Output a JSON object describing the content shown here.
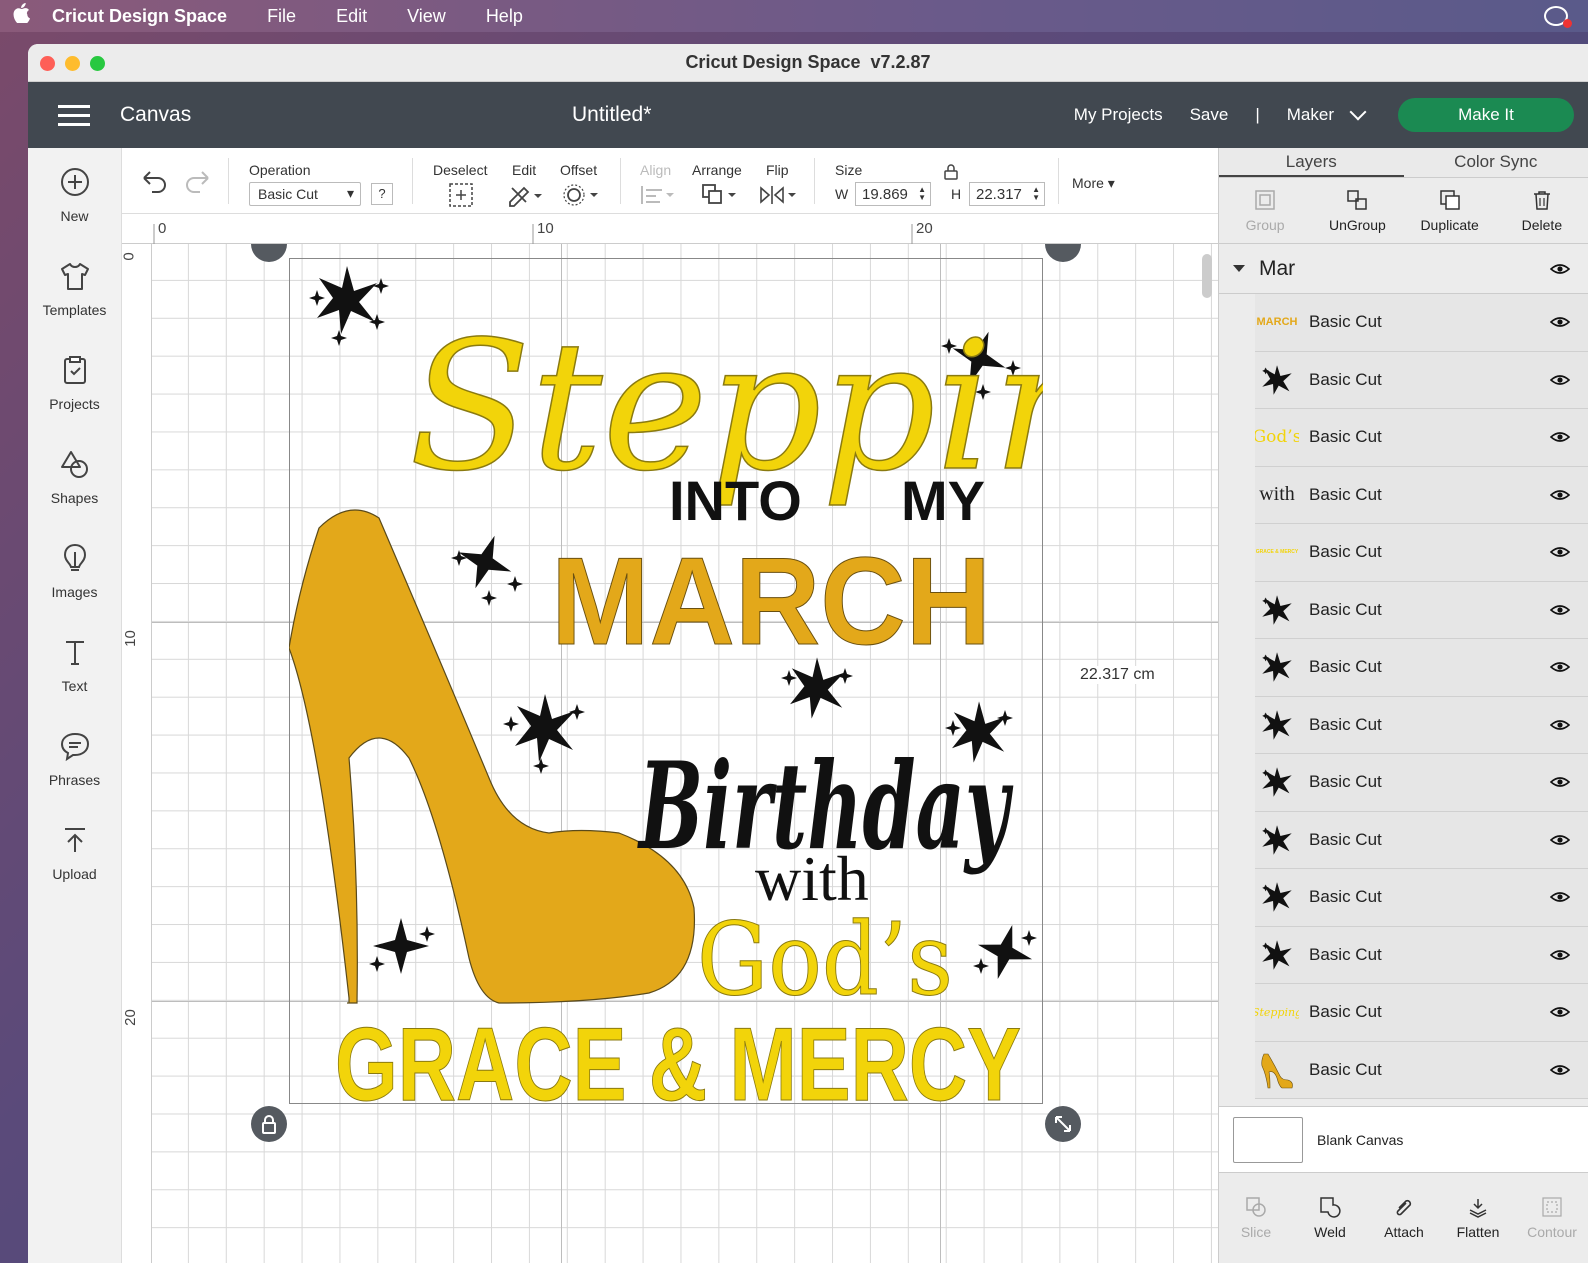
{
  "menubar": {
    "app_name": "Cricut Design Space",
    "items": [
      "File",
      "Edit",
      "View",
      "Help"
    ]
  },
  "window": {
    "title": "Cricut Design Space  v7.2.87"
  },
  "header": {
    "section": "Canvas",
    "document_title": "Untitled*",
    "my_projects": "My Projects",
    "save": "Save",
    "separator": "|",
    "machine": "Maker",
    "make_it": "Make It",
    "make_it_color": "#1b8a52"
  },
  "left_toolbar": [
    {
      "label": "New",
      "icon": "plus-circle-icon"
    },
    {
      "label": "Templates",
      "icon": "tshirt-icon"
    },
    {
      "label": "Projects",
      "icon": "projects-icon"
    },
    {
      "label": "Shapes",
      "icon": "shapes-icon"
    },
    {
      "label": "Images",
      "icon": "lightbulb-icon"
    },
    {
      "label": "Text",
      "icon": "text-icon"
    },
    {
      "label": "Phrases",
      "icon": "speech-bubble-icon"
    },
    {
      "label": "Upload",
      "icon": "upload-icon"
    }
  ],
  "edit_toolbar": {
    "operation_label": "Operation",
    "operation_value": "Basic Cut",
    "help": "?",
    "deselect": "Deselect",
    "edit": "Edit",
    "offset": "Offset",
    "align": "Align",
    "arrange": "Arrange",
    "flip": "Flip",
    "size": "Size",
    "w_label": "W",
    "w_value": "19.869",
    "h_label": "H",
    "h_value": "22.317",
    "more": "More"
  },
  "ruler": {
    "top": [
      "0",
      "10",
      "20"
    ],
    "left": [
      "0",
      "10",
      "20"
    ]
  },
  "canvas": {
    "dimension_label": "22.317 cm",
    "design": {
      "line1": "Stepping",
      "line2a": "INTO",
      "line2b": "MY",
      "line3": "MARCH",
      "line4": "Birthday",
      "line5": "with",
      "line6": "God’s",
      "line7": "GRACE & MERCY",
      "yellow": "#f2d40a",
      "gold": "#e3a81a",
      "black": "#111111"
    }
  },
  "right_panel": {
    "tabs": [
      "Layers",
      "Color Sync"
    ],
    "tools": [
      "Group",
      "UnGroup",
      "Duplicate",
      "Delete"
    ],
    "group_name": "Mar",
    "layers": [
      {
        "thumb": "MARCH",
        "label": "Basic Cut"
      },
      {
        "thumb": "star",
        "label": "Basic Cut"
      },
      {
        "thumb": "God’s",
        "label": "Basic Cut"
      },
      {
        "thumb": "with",
        "label": "Basic Cut"
      },
      {
        "thumb": "GRACE & MERCY",
        "label": "Basic Cut"
      },
      {
        "thumb": "star",
        "label": "Basic Cut"
      },
      {
        "thumb": "star",
        "label": "Basic Cut"
      },
      {
        "thumb": "star",
        "label": "Basic Cut"
      },
      {
        "thumb": "star",
        "label": "Basic Cut"
      },
      {
        "thumb": "star",
        "label": "Basic Cut"
      },
      {
        "thumb": "star",
        "label": "Basic Cut"
      },
      {
        "thumb": "star",
        "label": "Basic Cut"
      },
      {
        "thumb": "Stepping",
        "label": "Basic Cut"
      },
      {
        "thumb": "shoe",
        "label": "Basic Cut"
      }
    ],
    "blank_canvas": "Blank Canvas",
    "bottom_tools": [
      "Slice",
      "Weld",
      "Attach",
      "Flatten",
      "Contour"
    ]
  }
}
